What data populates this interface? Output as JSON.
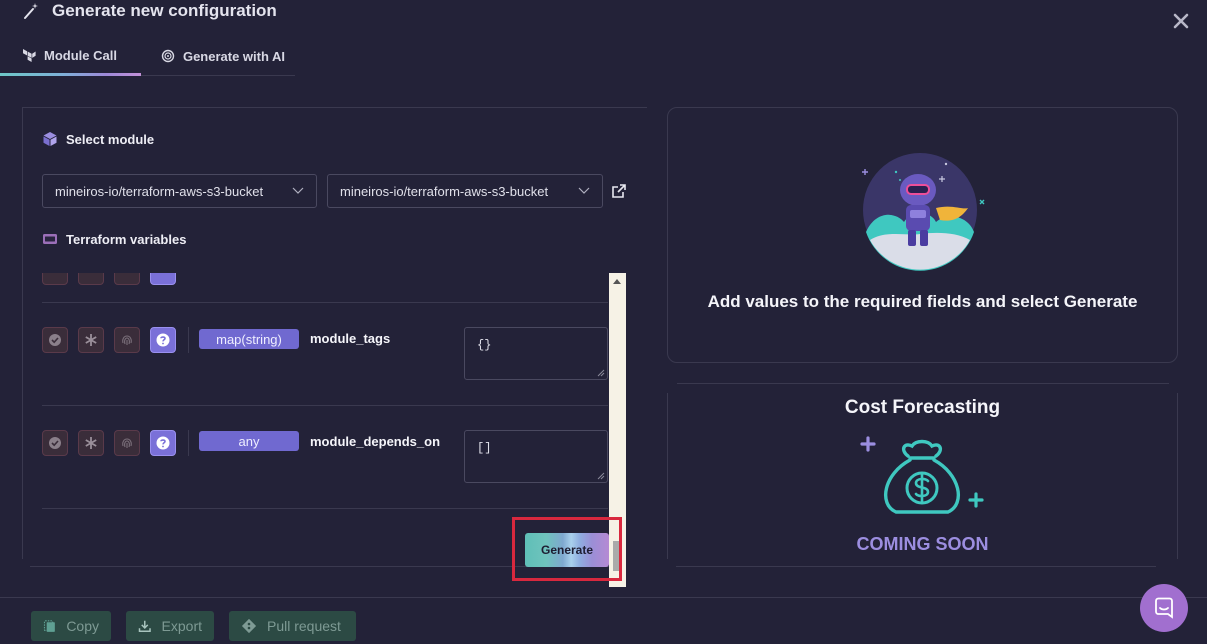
{
  "dialog": {
    "title": "Generate new configuration"
  },
  "tabs": [
    {
      "label": "Module Call",
      "active": true
    },
    {
      "label": "Generate with AI",
      "active": false
    }
  ],
  "select_module": {
    "heading": "Select module",
    "module_source": "mineiros-io/terraform-aws-s3-bucket",
    "module_name": "mineiros-io/terraform-aws-s3-bucket"
  },
  "terraform_variables": {
    "heading": "Terraform variables",
    "rows": [
      {
        "type": "map(string)",
        "name": "module_tags",
        "value": "{}"
      },
      {
        "type": "any",
        "name": "module_depends_on",
        "value": "[]"
      }
    ],
    "generate_label": "Generate"
  },
  "result_card": {
    "message": "Add values to the required fields and select Generate"
  },
  "cost_forecasting": {
    "title": "Cost Forecasting",
    "status": "COMING SOON"
  },
  "footer": {
    "copy_label": "Copy",
    "export_label": "Export",
    "pull_request_label": "Pull request"
  },
  "colors": {
    "accent": "#7069d0",
    "background": "#232238",
    "highlight": "#d8283e",
    "coming_soon": "#9c8ee0"
  }
}
